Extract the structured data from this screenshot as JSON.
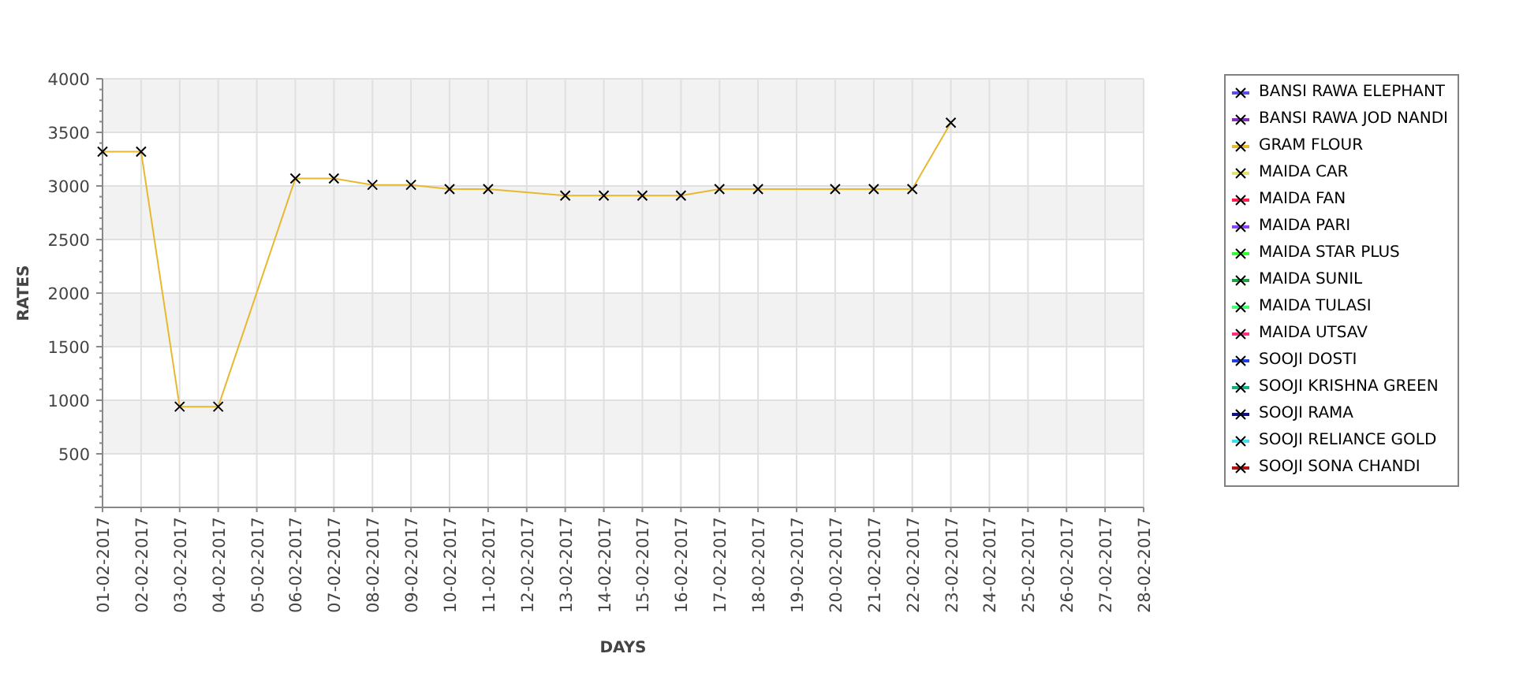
{
  "chart_data": {
    "type": "line",
    "grid": true,
    "xlabel": "DAYS",
    "ylabel": "RATES",
    "categories": [
      "01-02-2017",
      "02-02-2017",
      "03-02-2017",
      "04-02-2017",
      "05-02-2017",
      "06-02-2017",
      "07-02-2017",
      "08-02-2017",
      "09-02-2017",
      "10-02-2017",
      "11-02-2017",
      "12-02-2017",
      "13-02-2017",
      "14-02-2017",
      "15-02-2017",
      "16-02-2017",
      "17-02-2017",
      "18-02-2017",
      "19-02-2017",
      "20-02-2017",
      "21-02-2017",
      "22-02-2017",
      "23-02-2017",
      "24-02-2017",
      "25-02-2017",
      "26-02-2017",
      "27-02-2017",
      "28-02-2017"
    ],
    "ylim": [
      0,
      4000
    ],
    "yticks": [
      500,
      1000,
      1500,
      2000,
      2500,
      3000,
      3500,
      4000
    ],
    "series": [
      {
        "name": "BANSI RAWA ELEPHANT",
        "color": "#5a4fe0",
        "values": [
          null,
          null,
          null,
          null,
          null,
          null,
          null,
          null,
          null,
          null,
          null,
          null,
          null,
          null,
          null,
          null,
          null,
          null,
          null,
          null,
          null,
          null,
          null,
          null,
          null,
          null,
          null,
          null
        ]
      },
      {
        "name": "BANSI RAWA JOD NANDI",
        "color": "#8030b0",
        "values": [
          null,
          null,
          null,
          null,
          null,
          null,
          null,
          null,
          null,
          null,
          null,
          null,
          null,
          null,
          null,
          null,
          null,
          null,
          null,
          null,
          null,
          null,
          null,
          null,
          null,
          null,
          null,
          null
        ]
      },
      {
        "name": "GRAM FLOUR",
        "color": "#e8b830",
        "marker": "x",
        "values": [
          3320,
          3320,
          940,
          940,
          null,
          3070,
          3070,
          3010,
          3010,
          2970,
          2970,
          null,
          2910,
          2910,
          2910,
          2910,
          2970,
          2970,
          null,
          2970,
          2970,
          2970,
          3590,
          null,
          null,
          null,
          null,
          null
        ]
      },
      {
        "name": "MAIDA CAR",
        "color": "#e8e070",
        "values": [
          null,
          null,
          null,
          null,
          null,
          null,
          null,
          null,
          null,
          null,
          null,
          null,
          null,
          null,
          null,
          null,
          null,
          null,
          null,
          null,
          null,
          null,
          null,
          null,
          null,
          null,
          null,
          null
        ]
      },
      {
        "name": "MAIDA FAN",
        "color": "#ff2050",
        "values": [
          null,
          null,
          null,
          null,
          null,
          null,
          null,
          null,
          null,
          null,
          null,
          null,
          null,
          null,
          null,
          null,
          null,
          null,
          null,
          null,
          null,
          null,
          null,
          null,
          null,
          null,
          null,
          null
        ]
      },
      {
        "name": "MAIDA PARI",
        "color": "#9040ff",
        "values": [
          null,
          null,
          null,
          null,
          null,
          null,
          null,
          null,
          null,
          null,
          null,
          null,
          null,
          null,
          null,
          null,
          null,
          null,
          null,
          null,
          null,
          null,
          null,
          null,
          null,
          null,
          null,
          null
        ]
      },
      {
        "name": "MAIDA STAR PLUS",
        "color": "#30ff30",
        "values": [
          null,
          null,
          null,
          null,
          null,
          null,
          null,
          null,
          null,
          null,
          null,
          null,
          null,
          null,
          null,
          null,
          null,
          null,
          null,
          null,
          null,
          null,
          null,
          null,
          null,
          null,
          null,
          null
        ]
      },
      {
        "name": "MAIDA SUNIL",
        "color": "#20a040",
        "values": [
          null,
          null,
          null,
          null,
          null,
          null,
          null,
          null,
          null,
          null,
          null,
          null,
          null,
          null,
          null,
          null,
          null,
          null,
          null,
          null,
          null,
          null,
          null,
          null,
          null,
          null,
          null,
          null
        ]
      },
      {
        "name": "MAIDA TULASI",
        "color": "#40ff70",
        "values": [
          null,
          null,
          null,
          null,
          null,
          null,
          null,
          null,
          null,
          null,
          null,
          null,
          null,
          null,
          null,
          null,
          null,
          null,
          null,
          null,
          null,
          null,
          null,
          null,
          null,
          null,
          null,
          null
        ]
      },
      {
        "name": "MAIDA UTSAV",
        "color": "#ff3080",
        "values": [
          null,
          null,
          null,
          null,
          null,
          null,
          null,
          null,
          null,
          null,
          null,
          null,
          null,
          null,
          null,
          null,
          null,
          null,
          null,
          null,
          null,
          null,
          null,
          null,
          null,
          null,
          null,
          null
        ]
      },
      {
        "name": "SOOJI DOSTI",
        "color": "#2040e0",
        "values": [
          null,
          null,
          null,
          null,
          null,
          null,
          null,
          null,
          null,
          null,
          null,
          null,
          null,
          null,
          null,
          null,
          null,
          null,
          null,
          null,
          null,
          null,
          null,
          null,
          null,
          null,
          null,
          null
        ]
      },
      {
        "name": "SOOJI KRISHNA GREEN",
        "color": "#10b080",
        "values": [
          null,
          null,
          null,
          null,
          null,
          null,
          null,
          null,
          null,
          null,
          null,
          null,
          null,
          null,
          null,
          null,
          null,
          null,
          null,
          null,
          null,
          null,
          null,
          null,
          null,
          null,
          null,
          null
        ]
      },
      {
        "name": "SOOJI RAMA",
        "color": "#101080",
        "values": [
          null,
          null,
          null,
          null,
          null,
          null,
          null,
          null,
          null,
          null,
          null,
          null,
          null,
          null,
          null,
          null,
          null,
          null,
          null,
          null,
          null,
          null,
          null,
          null,
          null,
          null,
          null,
          null
        ]
      },
      {
        "name": "SOOJI RELIANCE GOLD",
        "color": "#40e0f0",
        "values": [
          null,
          null,
          null,
          null,
          null,
          null,
          null,
          null,
          null,
          null,
          null,
          null,
          null,
          null,
          null,
          null,
          null,
          null,
          null,
          null,
          null,
          null,
          null,
          null,
          null,
          null,
          null,
          null
        ]
      },
      {
        "name": "SOOJI SONA CHANDI",
        "color": "#b01010",
        "values": [
          null,
          null,
          null,
          null,
          null,
          null,
          null,
          null,
          null,
          null,
          null,
          null,
          null,
          null,
          null,
          null,
          null,
          null,
          null,
          null,
          null,
          null,
          null,
          null,
          null,
          null,
          null,
          null
        ]
      }
    ]
  }
}
